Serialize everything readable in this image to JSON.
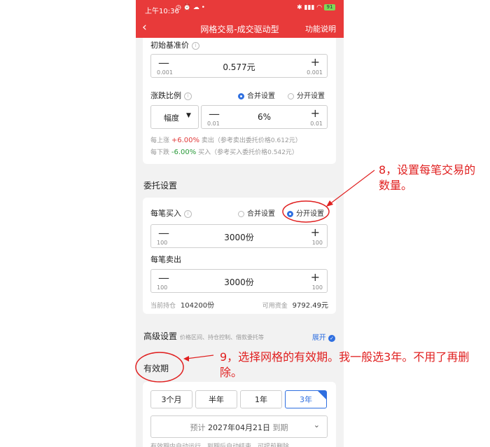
{
  "status": {
    "time": "上午10:36",
    "battery": "91"
  },
  "nav": {
    "back": "‹",
    "title": "网格交易-成交驱动型",
    "help": "功能说明"
  },
  "base": {
    "label": "初始基准价",
    "minus": "—",
    "plus": "+",
    "left_step": "0.001",
    "right_step": "0.001",
    "value": "0.577元"
  },
  "ratio": {
    "label": "涨跌比例",
    "opt1": "合并设置",
    "opt2": "分开设置",
    "dropdown": "幅度",
    "minus": "—",
    "plus": "+",
    "left_step": "0.01",
    "right_step": "0.01",
    "value": "6%",
    "up_prefix": "每上涨",
    "up_pct": "+6.00%",
    "up_suffix": "卖出（参考卖出委托价格0.612元）",
    "down_prefix": "每下跌",
    "down_pct": "-6.00%",
    "down_suffix": "买入（参考买入委托价格0.542元）"
  },
  "order": {
    "section": "委托设置",
    "buy_label": "每笔买入",
    "opt1": "合并设置",
    "opt2": "分开设置",
    "buy_minus": "—",
    "buy_plus": "+",
    "buy_lstep": "100",
    "buy_rstep": "100",
    "buy_value": "3000份",
    "sell_label": "每笔卖出",
    "sell_minus": "—",
    "sell_plus": "+",
    "sell_lstep": "100",
    "sell_rstep": "100",
    "sell_value": "3000份",
    "holding_label": "当前持仓",
    "holding_value": "104200份",
    "cash_label": "可用资金",
    "cash_value": "9792.49元"
  },
  "advanced": {
    "label": "高级设置",
    "note": "价格区间、持仓控制、借款委托等",
    "expand": "展开"
  },
  "validity": {
    "label": "有效期",
    "options": [
      "3个月",
      "半年",
      "1年",
      "3年"
    ],
    "selected": "3年",
    "prefix": "预计",
    "date": "2027年04月21日",
    "suffix": "到期",
    "cut_text": "有效期内自动运行，到期后自动结束，可提前删除"
  },
  "annotations": {
    "a8": "8，设置每笔交易的数量。",
    "a9": "9，选择网格的有效期。我一般选3年。不用了再删除。"
  },
  "colors": {
    "brand_red": "#e83a3a",
    "accent_blue": "#2f6fe0",
    "annotation_red": "#e02020"
  }
}
